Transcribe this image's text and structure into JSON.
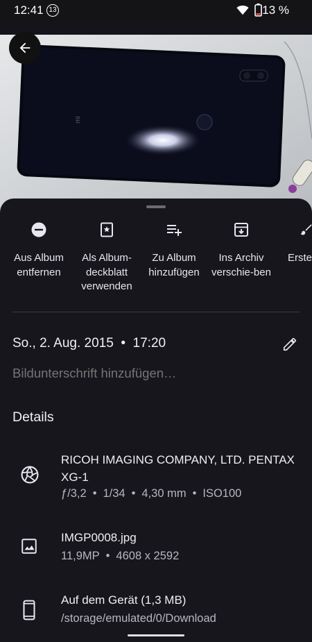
{
  "status_bar": {
    "time": "12:41",
    "notification_count": "13",
    "battery": "13 %"
  },
  "actions": [
    {
      "label": "Aus Album entfernen",
      "icon": "remove-circle-icon"
    },
    {
      "label": "Als Album-deckblatt verwenden",
      "icon": "star-frame-icon"
    },
    {
      "label": "Zu Album hinzufügen",
      "icon": "playlist-add-icon"
    },
    {
      "label": "Ins Archiv verschie-ben",
      "icon": "archive-icon"
    },
    {
      "label": "Erste",
      "icon": "brush-icon"
    }
  ],
  "info": {
    "date_time": "So., 2. Aug. 2015  •  17:20",
    "caption_placeholder": "Bildunterschrift hinzufügen…",
    "details_heading": "Details"
  },
  "details": {
    "camera": {
      "title": "RICOH IMAGING COMPANY, LTD. PENTAX XG-1",
      "aperture": "ƒ/3,2",
      "shutter": "1/34",
      "focal": "4,30 mm",
      "iso": "ISO100"
    },
    "file": {
      "title": "IMGP0008.jpg",
      "megapixels": "11,9MP",
      "resolution": "4608 x 2592"
    },
    "storage": {
      "title": "Auf dem Gerät (1,3 MB)",
      "path": "/storage/emulated/0/Download"
    }
  },
  "colors": {
    "sheet_background": "#16161c",
    "text_primary": "#f1eff6",
    "text_secondary": "#b8b6c0"
  }
}
